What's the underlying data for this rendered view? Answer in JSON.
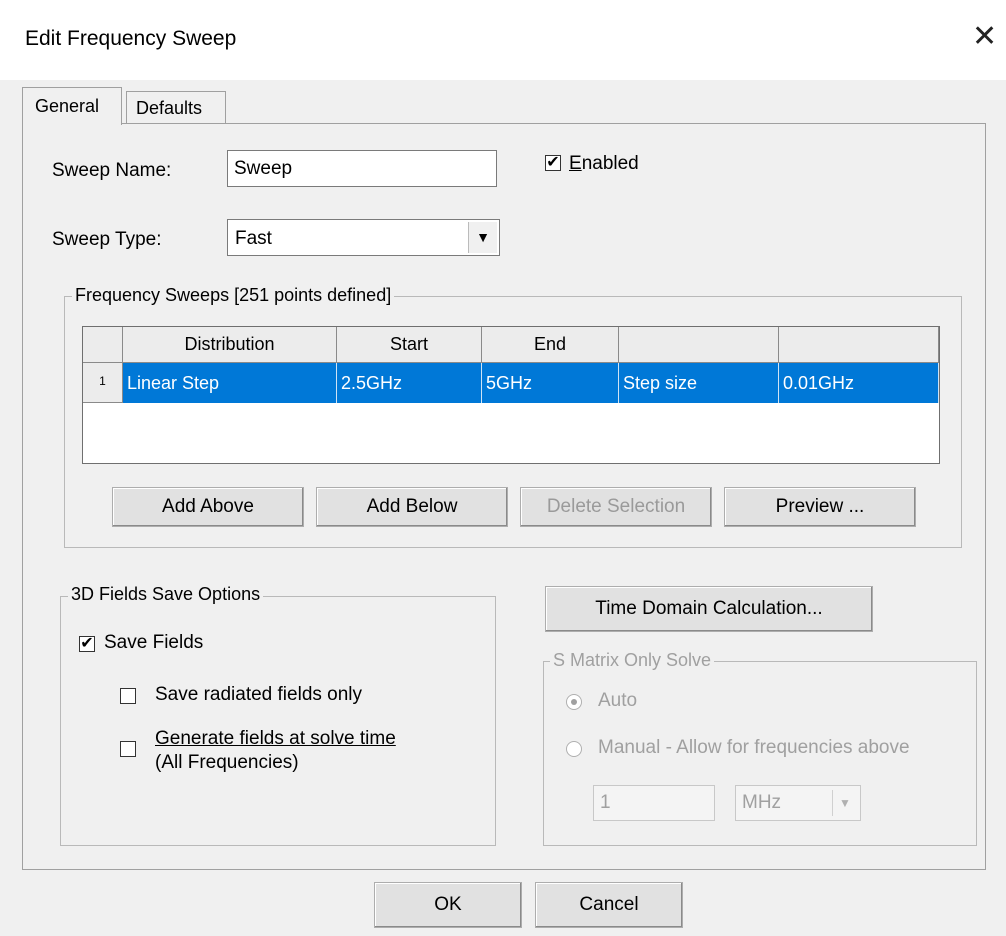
{
  "window": {
    "title": "Edit Frequency Sweep",
    "close_glyph": "✕"
  },
  "tabs": [
    {
      "label": "General",
      "active": true
    },
    {
      "label": "Defaults",
      "active": false
    }
  ],
  "sweep_name": {
    "label": "Sweep Name:",
    "value": "Sweep"
  },
  "enabled": {
    "label": "Enabled",
    "checked": true
  },
  "sweep_type": {
    "label": "Sweep Type:",
    "value": "Fast"
  },
  "freq_sweeps": {
    "title": "Frequency Sweeps [251 points defined]",
    "columns": [
      "Distribution",
      "Start",
      "End",
      "",
      ""
    ],
    "rows": [
      {
        "index": "1",
        "cells": [
          "Linear Step",
          "2.5GHz",
          "5GHz",
          "Step size",
          "0.01GHz"
        ]
      }
    ],
    "buttons": {
      "add_above": "Add Above",
      "add_below": "Add Below",
      "delete": "Delete Selection",
      "preview": "Preview ..."
    }
  },
  "fields_save": {
    "title": "3D Fields Save Options",
    "save_fields": {
      "label": "Save Fields",
      "checked": true
    },
    "save_radiated": {
      "label": "Save radiated fields only",
      "checked": false
    },
    "generate": {
      "label_line1": "Generate fields at solve time",
      "label_line2": "(All Frequencies)",
      "checked": false
    }
  },
  "time_domain_button": "Time Domain Calculation...",
  "s_matrix": {
    "title": "S Matrix Only Solve",
    "auto": "Auto",
    "manual": "Manual -  Allow for frequencies above",
    "value": "1",
    "unit": "MHz"
  },
  "footer": {
    "ok": "OK",
    "cancel": "Cancel"
  },
  "colors": {
    "selection": "#0078d7",
    "dialog_bg": "#f0f0f0",
    "disabled_text": "#a0a0a0"
  }
}
